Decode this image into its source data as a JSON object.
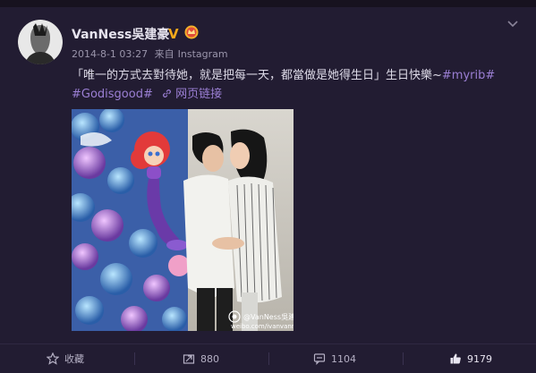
{
  "post": {
    "username": "VanNess吳建豪",
    "verified_mark": "V",
    "timestamp": "2014-8-1 03:27",
    "source_prefix": "来自",
    "source": "Instagram",
    "text_quote": "「唯一的方式去對待她，就是把每一天，都當做是她得生日」生日快樂~",
    "hashtag1": "#myrib#",
    "hashtag2": "#Godisgood#",
    "web_link_label": "网页链接",
    "watermark_line1": "@VanNess吳建豪",
    "watermark_line2": "weibo.com/ivanvanness"
  },
  "actions": {
    "favorite_label": "收藏",
    "repost_count": "880",
    "comment_count": "1104",
    "like_count": "9179"
  },
  "colors": {
    "background": "#221c32",
    "accent": "#9b7fd4",
    "verified": "#f3a81b"
  }
}
